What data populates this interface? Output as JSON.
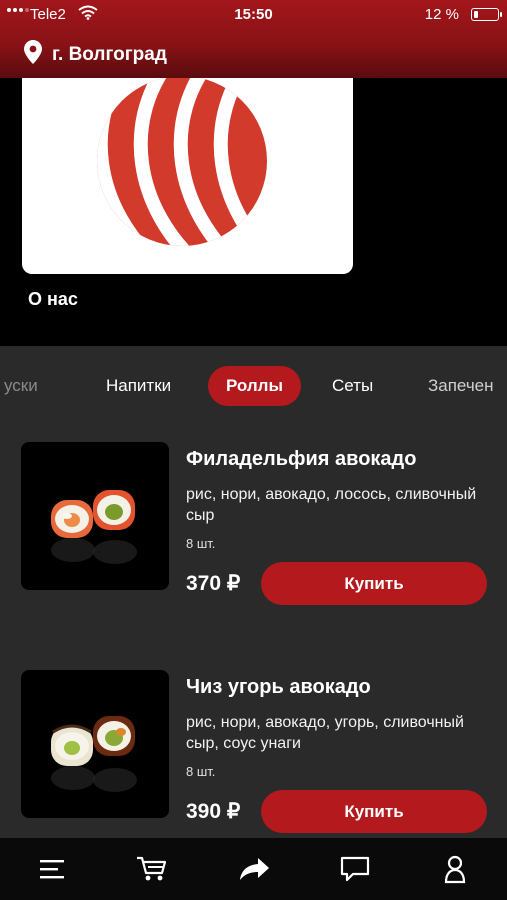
{
  "status_bar": {
    "carrier": "Tele2",
    "time": "15:50",
    "battery": "12 %"
  },
  "header": {
    "city": "г. Волгоград"
  },
  "banner": {
    "label": "О нас"
  },
  "categories": {
    "tabs": [
      "уски",
      "Напитки",
      "Роллы",
      "Сеты",
      "Запечен"
    ],
    "active": "Роллы"
  },
  "products": [
    {
      "name": "Филадельфия авокадо",
      "description": "рис, нори, авокадо, лосось, сливочный сыр",
      "quantity": "8 шт.",
      "price": "370 ₽",
      "buy_label": "Купить"
    },
    {
      "name": "Чиз угорь авокадо",
      "description": "рис, нори, авокадо, угорь, сливочный сыр, соус унаги",
      "quantity": "8 шт.",
      "price": "390 ₽",
      "buy_label": "Купить"
    }
  ],
  "bottom_nav": {
    "icons": [
      "menu-icon",
      "cart-icon",
      "share-icon",
      "chat-icon",
      "profile-icon"
    ]
  },
  "colors": {
    "accent": "#b3191d",
    "header": "#8a1216",
    "background": "#2a2a2a"
  }
}
